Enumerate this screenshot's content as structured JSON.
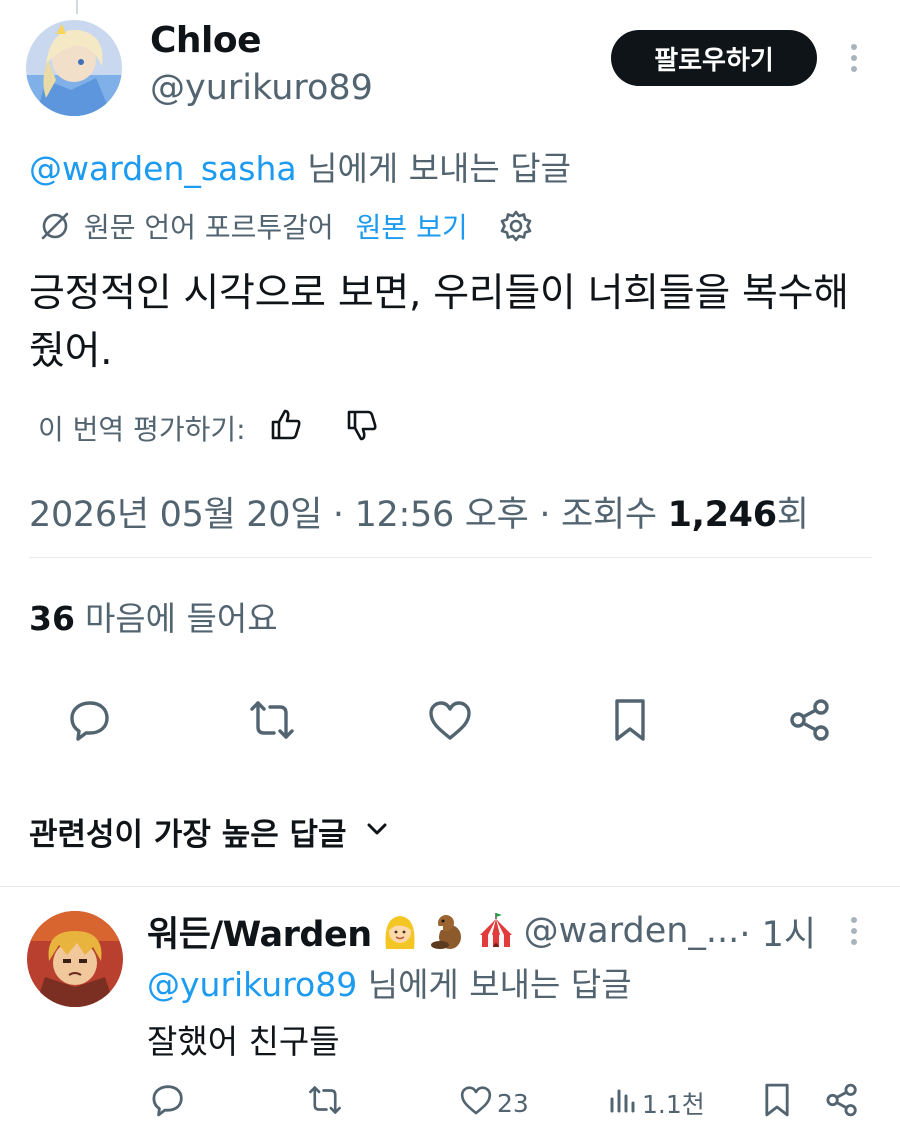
{
  "post": {
    "author_name": "Chloe",
    "author_handle": "@yurikuro89",
    "follow_label": "팔로우하기",
    "reply_to_handle": "@warden_sasha",
    "reply_to_suffix": " 님에게 보내는 답글",
    "translation": {
      "source_lang": "원문 언어 포르투갈어",
      "view_original": "원본 보기"
    },
    "text": "긍정적인 시각으로 보면, 우리들이 너희들을 복수해 줬어.",
    "rate_label": "이 번역 평가하기:",
    "timestamp": "2026년 05월 20일 · 12:56 오후 · 조회수 ",
    "views": "1,246",
    "views_suffix": "회",
    "likes_count": "36",
    "likes_label": "마음에 들어요"
  },
  "actions": {
    "icons": [
      "reply-icon",
      "repost-icon",
      "like-icon",
      "bookmark-icon",
      "share-icon"
    ]
  },
  "replies_section": {
    "sort_label": "관련성이 가장 높은 답글"
  },
  "reply": {
    "author_name": "워든/Warden",
    "author_handle": "@warden_...",
    "time": " · 1시",
    "reply_to_handle": "@yurikuro89",
    "reply_to_suffix": " 님에게 보내는 답글",
    "text": "잘했어 친구들",
    "like_count": "23",
    "view_count": "1.1천"
  },
  "colors": {
    "accent": "#1d9bf0",
    "text_primary": "#0f1419",
    "text_secondary": "#536471",
    "follow_button": "#0f1419"
  }
}
